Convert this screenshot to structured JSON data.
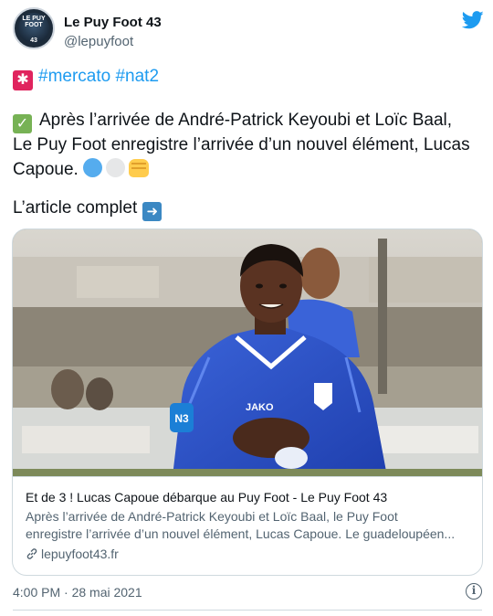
{
  "account": {
    "name": "Le Puy Foot 43",
    "handle": "@lepuyfoot",
    "avatar_wordmark": "LE PUY FOOT",
    "avatar_number": "43"
  },
  "tweet": {
    "hashtags": [
      "#mercato",
      "#nat2"
    ],
    "line1": "Après l’arrivée de André-Patrick Keyoubi et Loïc Baal,",
    "line2": "Le Puy Foot enregistre l’arrivée d’un nouvel élément, Lucas",
    "line3": "Capoue.",
    "line4": "L’article complet"
  },
  "card": {
    "title": "Et de 3 ! Lucas Capoue débarque au Puy Foot - Le Puy Foot 43",
    "desc_line1": "Après l’arrivée de André-Patrick Keyoubi et Loïc Baal, le Puy Foot",
    "desc_line2": "enregistre l’arrivée d’un nouvel élément, Lucas Capoue. Le guadeloupéen...",
    "domain": "lepuyfoot43.fr",
    "jersey_text": "JAKO",
    "badge_text": "N3"
  },
  "footer": {
    "timestamp": "4:00 PM · 28 mai 2021",
    "info_glyph": "i"
  },
  "icons": {
    "twitter_bird": "twitter-bird-icon",
    "siren": "rotating-light-icon",
    "check": "white-check-mark-icon",
    "blue_circle": "blue-circle-icon",
    "white_circle": "white-circle-icon",
    "fist": "oncoming-fist-icon",
    "arrow": "right-arrow-icon",
    "link": "link-icon",
    "info": "info-icon"
  },
  "colors": {
    "accent": "#1d9bf0",
    "text": "#0f1419",
    "muted": "#536471",
    "border": "#cfd9de",
    "jersey": "#2f55c9"
  }
}
